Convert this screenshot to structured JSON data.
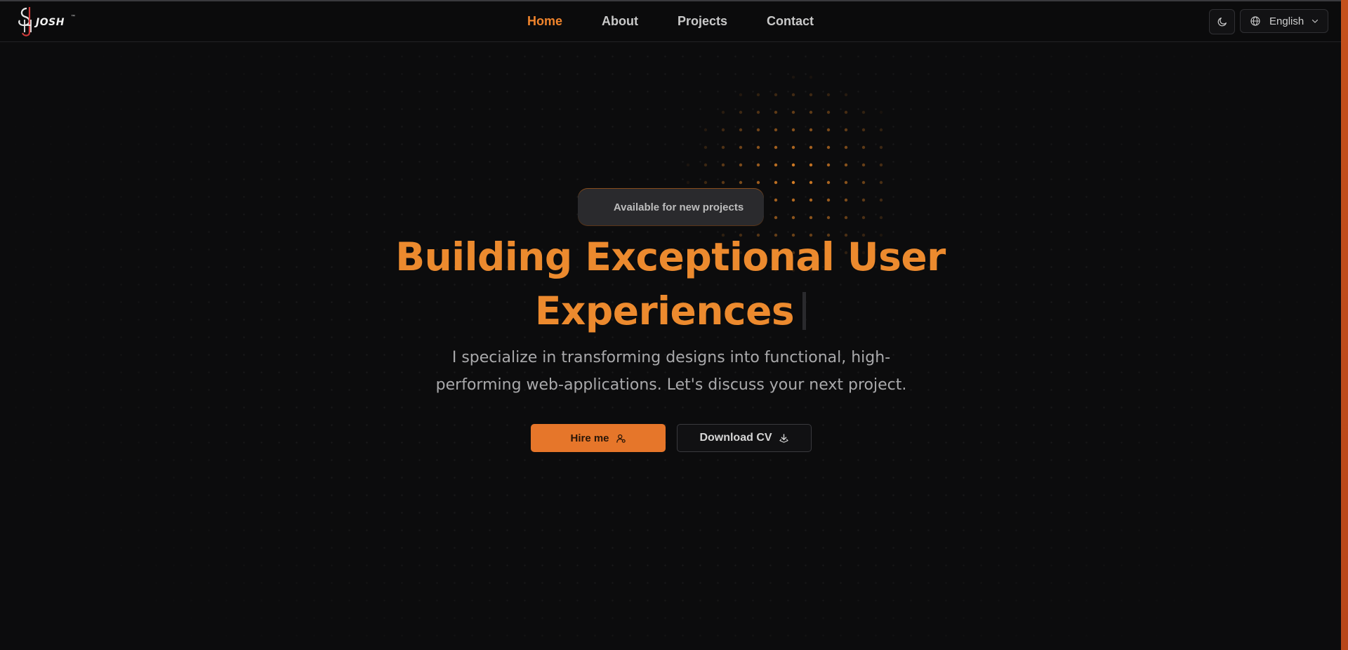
{
  "brand": {
    "name": "JOSH",
    "trademark": "™",
    "accent_color": "#ec8a2e"
  },
  "nav": {
    "items": [
      {
        "label": "Home",
        "active": true
      },
      {
        "label": "About",
        "active": false
      },
      {
        "label": "Projects",
        "active": false
      },
      {
        "label": "Contact",
        "active": false
      }
    ]
  },
  "header_controls": {
    "theme_icon": "moon-icon",
    "language_icon": "globe-icon",
    "language_label": "English",
    "language_chevron_icon": "chevron-down-icon"
  },
  "hero": {
    "badge_text": "Available for new projects",
    "headline_line1": "Building Exceptional User",
    "headline_line2": "Experiences",
    "subtitle_line1": "I specialize in transforming designs into functional, high-",
    "subtitle_line2": "performing web-applications. Let's discuss your next project.",
    "primary_button": {
      "label": "Hire me",
      "icon": "user-icon"
    },
    "secondary_button": {
      "label": "Download CV",
      "icon": "download-icon"
    }
  }
}
